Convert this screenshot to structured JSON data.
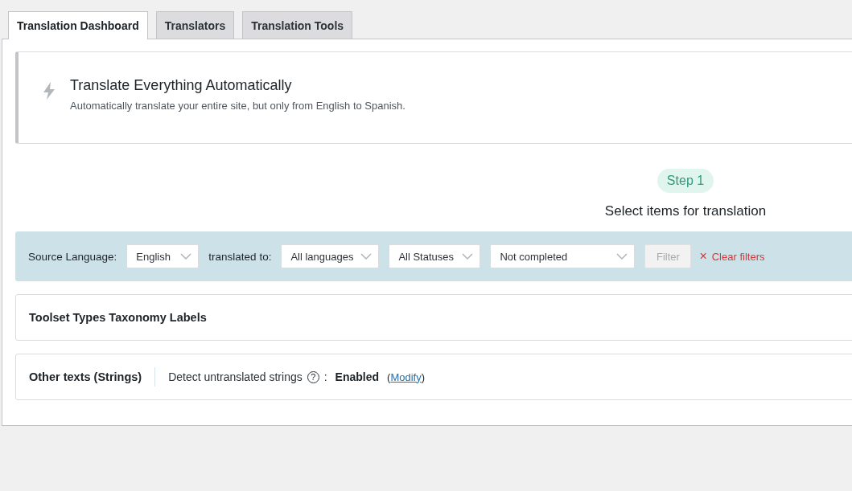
{
  "tabs": [
    {
      "label": "Translation Dashboard",
      "selected": true
    },
    {
      "label": "Translators",
      "selected": false
    },
    {
      "label": "Translation Tools",
      "selected": false
    }
  ],
  "notice": {
    "title": "Translate Everything Automatically",
    "description": "Automatically translate your entire site, but only from English to Spanish."
  },
  "step": {
    "badge": "Step 1",
    "title": "Select items for translation"
  },
  "filters": {
    "source_label": "Source Language:",
    "source_value": "English",
    "translated_label": "translated to:",
    "target_value": "All languages",
    "status_value": "All Statuses",
    "completion_value": "Not completed",
    "filter_button": {
      "label": "Filter",
      "disabled": true
    },
    "clear_icon": "×",
    "clear_label": "Clear filters"
  },
  "sections": [
    {
      "kind": "simple",
      "title": "Toolset Types Taxonomy Labels"
    },
    {
      "kind": "strings",
      "title": "Other texts (Strings)",
      "setting_label": "Detect untranslated strings",
      "help_icon": "?",
      "colon": ":",
      "status": "Enabled",
      "open_paren": "(",
      "link": "Modify",
      "close_paren": ")"
    }
  ]
}
